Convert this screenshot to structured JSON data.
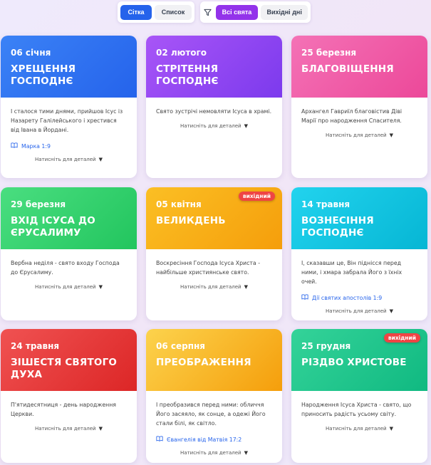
{
  "toolbar": {
    "view": {
      "grid_label": "Сітка",
      "list_label": "Список"
    },
    "filter": {
      "all_label": "Всі свята",
      "weekend_label": "Вихідні дні"
    }
  },
  "card_more_label": "Натисніть для деталей",
  "badge_label": "вихідний",
  "cards": [
    {
      "date": "06 січня",
      "title": "ХРЕЩЕННЯ ГОСПОДНЄ",
      "desc": "І сталося тими днями, прийшов Ісус із Назарету Галілейського і хрестився від Івана в Йордані.",
      "ref": "Марка 1:9",
      "color": "blue"
    },
    {
      "date": "02 лютого",
      "title": "СТРІТЕННЯ ГОСПОДНЄ",
      "desc": "Свято зустрічі немовляти Ісуса в храмі.",
      "color": "purple"
    },
    {
      "date": "25 березня",
      "title": "БЛАГОВІЩЕННЯ",
      "desc": "Архангел Гавриїл благовістив Діві Марії про народження Спасителя.",
      "color": "pink"
    },
    {
      "date": "29 березня",
      "title": "ВХІД ІСУСА ДО ЄРУСАЛИМУ",
      "desc": "Вербна неділя - свято входу Господа до Єрусалиму.",
      "color": "green"
    },
    {
      "date": "05 квітня",
      "title": "ВЕЛИКДЕНЬ",
      "desc": "Воскресіння Господа Ісуса Христа - найбільше християнське свято.",
      "badge": true,
      "color": "orange"
    },
    {
      "date": "14 травня",
      "title": "ВОЗНЕСІННЯ ГОСПОДНЄ",
      "desc": "І, сказавши це, Він піднісся перед ними, і хмара забрала Його з їхніх очей.",
      "ref": "Дії святих апостолів 1:9",
      "color": "cyan"
    },
    {
      "date": "24 травня",
      "title": "ЗІШЕСТЯ СВЯТОГО ДУХА",
      "desc": "П'ятидесятниця - день народження Церкви.",
      "color": "red"
    },
    {
      "date": "06 серпня",
      "title": "ПРЕОБРАЖЕННЯ",
      "desc": "І преобразився перед ними: обличчя Його засяяло, як сонце, а одежі Його стали білі, як світло.",
      "ref": "Євангелія від Матвія 17:2",
      "color": "amber"
    },
    {
      "date": "25 грудня",
      "title": "РІЗДВО ХРИСТОВЕ",
      "desc": "Народження Ісуса Христа - свято, що приносить радість усьому світу.",
      "badge": true,
      "color": "emerald"
    }
  ]
}
